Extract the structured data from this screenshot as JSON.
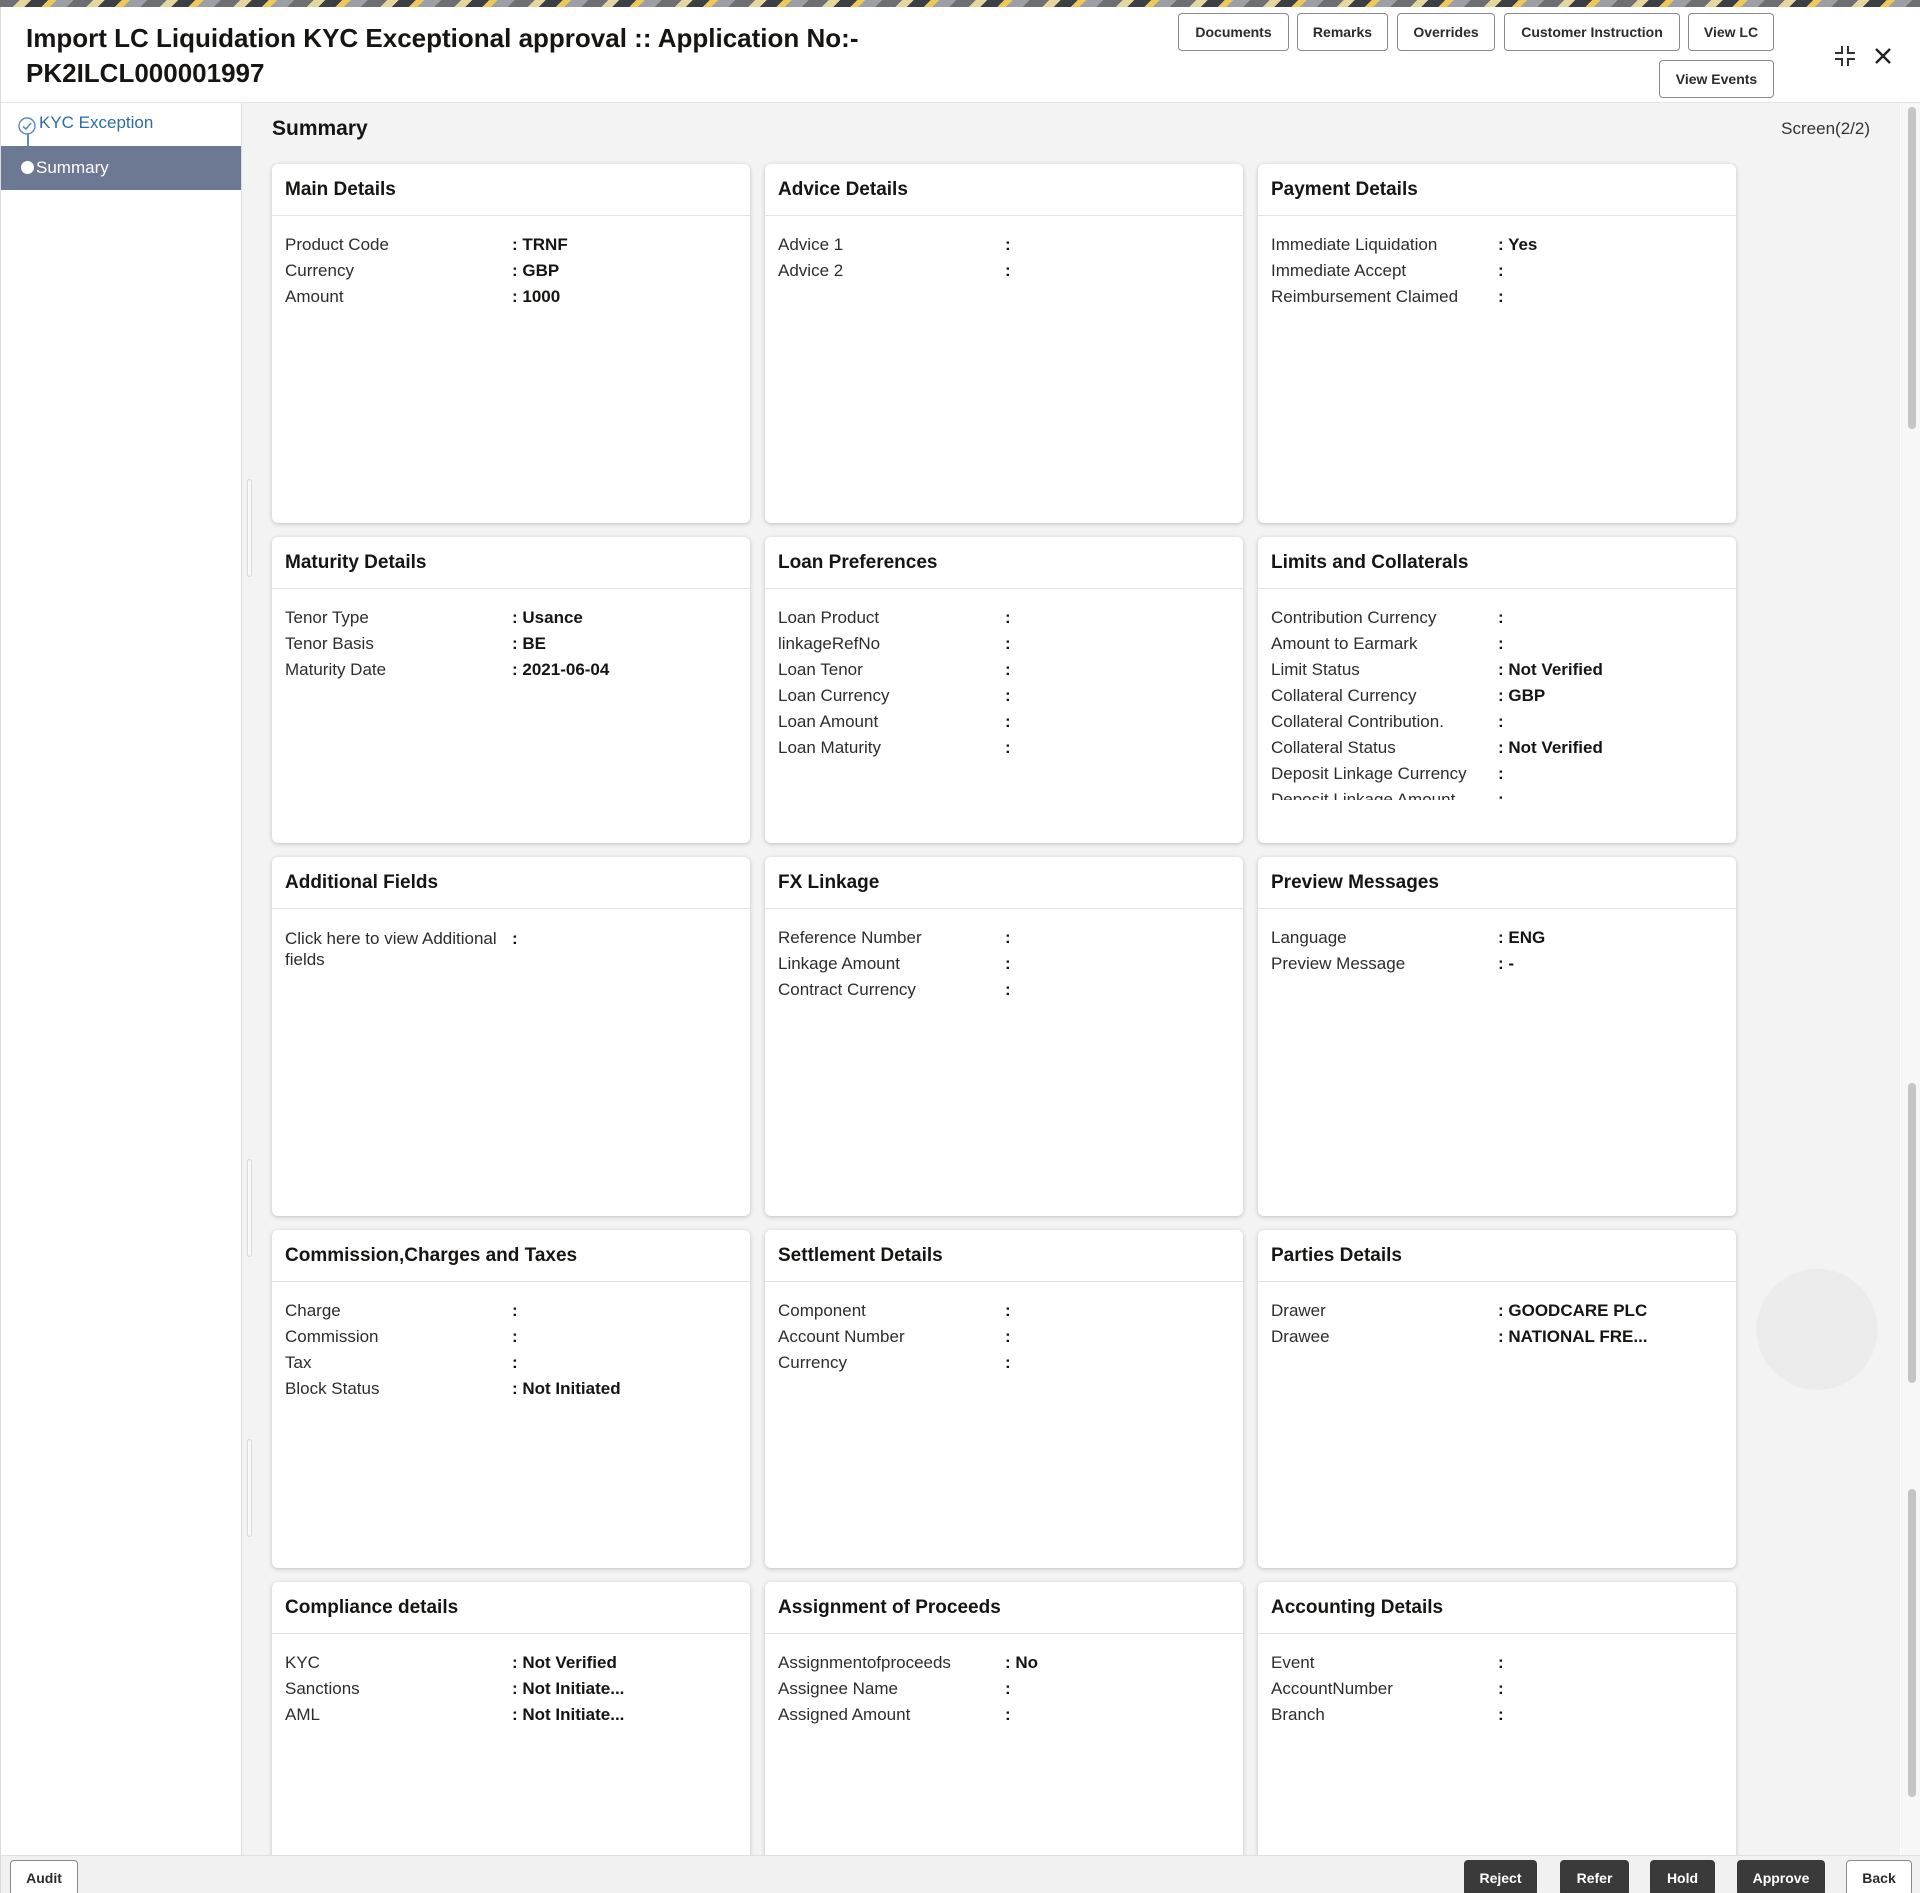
{
  "header": {
    "title_line1": "Import LC Liquidation KYC Exceptional approval :: Application No:-",
    "title_line2": "PK2ILCL000001997",
    "buttons": {
      "documents": "Documents",
      "remarks": "Remarks",
      "overrides": "Overrides",
      "customer_instruction": "Customer Instruction",
      "view_lc": "View LC",
      "view_events": "View Events"
    }
  },
  "nav": {
    "items": [
      {
        "label": "KYC Exception",
        "state": "completed"
      },
      {
        "label": "Summary",
        "state": "active"
      }
    ]
  },
  "main": {
    "title": "Summary",
    "screen_indicator": "Screen(2/2)"
  },
  "cards": {
    "main_details": {
      "title": "Main Details",
      "rows": [
        {
          "label": "Product Code",
          "value": ": TRNF"
        },
        {
          "label": "Currency",
          "value": ": GBP"
        },
        {
          "label": "Amount",
          "value": ": 1000"
        }
      ]
    },
    "advice_details": {
      "title": "Advice Details",
      "rows": [
        {
          "label": "Advice 1",
          "value": ":"
        },
        {
          "label": "Advice 2",
          "value": ":"
        }
      ]
    },
    "payment_details": {
      "title": "Payment Details",
      "rows": [
        {
          "label": "Immediate Liquidation",
          "value": ": Yes"
        },
        {
          "label": "Immediate Accept",
          "value": ":"
        },
        {
          "label": "Reimbursement Claimed",
          "value": ":"
        }
      ]
    },
    "maturity_details": {
      "title": "Maturity Details",
      "rows": [
        {
          "label": "Tenor Type",
          "value": ": Usance"
        },
        {
          "label": "Tenor Basis",
          "value": ": BE"
        },
        {
          "label": "Maturity Date",
          "value": ": 2021-06-04"
        }
      ]
    },
    "loan_preferences": {
      "title": "Loan Preferences",
      "rows": [
        {
          "label": "Loan Product",
          "value": ":"
        },
        {
          "label": "linkageRefNo",
          "value": ":"
        },
        {
          "label": "Loan Tenor",
          "value": ":"
        },
        {
          "label": "Loan Currency",
          "value": ":"
        },
        {
          "label": "Loan Amount",
          "value": ":"
        },
        {
          "label": "Loan Maturity",
          "value": ":"
        }
      ]
    },
    "limits_collaterals": {
      "title": "Limits and Collaterals",
      "rows": [
        {
          "label": "Contribution Currency",
          "value": ":"
        },
        {
          "label": "Amount to Earmark",
          "value": ":"
        },
        {
          "label": "Limit Status",
          "value": ": Not Verified"
        },
        {
          "label": "Collateral Currency",
          "value": ": GBP"
        },
        {
          "label": "Collateral Contribution.",
          "value": ":"
        },
        {
          "label": "Collateral Status",
          "value": ": Not Verified"
        },
        {
          "label": "Deposit Linkage Currency",
          "value": ":"
        },
        {
          "label": "Deposit Linkage Amount",
          "value": ":"
        }
      ]
    },
    "additional_fields": {
      "title": "Additional Fields",
      "rows": [
        {
          "label": "Click here to view Additional fields",
          "value": ":"
        }
      ]
    },
    "fx_linkage": {
      "title": "FX Linkage",
      "rows": [
        {
          "label": "Reference Number",
          "value": ":"
        },
        {
          "label": "Linkage Amount",
          "value": ":"
        },
        {
          "label": "Contract Currency",
          "value": ":"
        }
      ]
    },
    "preview_messages": {
      "title": "Preview Messages",
      "rows": [
        {
          "label": "Language",
          "value": ": ENG"
        },
        {
          "label": "Preview Message",
          "value": ": -"
        }
      ]
    },
    "commission_charges": {
      "title": "Commission,Charges and Taxes",
      "rows": [
        {
          "label": "Charge",
          "value": ":"
        },
        {
          "label": "Commission",
          "value": ":"
        },
        {
          "label": "Tax",
          "value": ":"
        },
        {
          "label": "Block Status",
          "value": ": Not Initiated"
        }
      ]
    },
    "settlement_details": {
      "title": "Settlement Details",
      "rows": [
        {
          "label": "Component",
          "value": ":"
        },
        {
          "label": "Account Number",
          "value": ":"
        },
        {
          "label": "Currency",
          "value": ":"
        }
      ]
    },
    "parties_details": {
      "title": "Parties Details",
      "rows": [
        {
          "label": "Drawer",
          "value": ": GOODCARE PLC"
        },
        {
          "label": "Drawee",
          "value": ": NATIONAL FRE..."
        }
      ]
    },
    "compliance_details": {
      "title": "Compliance details",
      "rows": [
        {
          "label": "KYC",
          "value": ": Not Verified"
        },
        {
          "label": "Sanctions",
          "value": ": Not Initiate..."
        },
        {
          "label": "AML",
          "value": ": Not Initiate..."
        }
      ]
    },
    "assignment_proceeds": {
      "title": "Assignment of Proceeds",
      "rows": [
        {
          "label": "Assignmentofproceeds",
          "value": ": No"
        },
        {
          "label": "Assignee Name",
          "value": ":"
        },
        {
          "label": "Assigned Amount",
          "value": ":"
        }
      ]
    },
    "accounting_details": {
      "title": "Accounting Details",
      "rows": [
        {
          "label": "Event",
          "value": ":"
        },
        {
          "label": "AccountNumber",
          "value": ":"
        },
        {
          "label": "Branch",
          "value": ":"
        }
      ]
    }
  },
  "footer": {
    "audit": "Audit",
    "reject": "Reject",
    "refer": "Refer",
    "hold": "Hold",
    "approve": "Approve",
    "back": "Back"
  },
  "icons": {
    "minimize": "minimize-icon",
    "close": "close-icon",
    "check": "check-circle-icon"
  }
}
